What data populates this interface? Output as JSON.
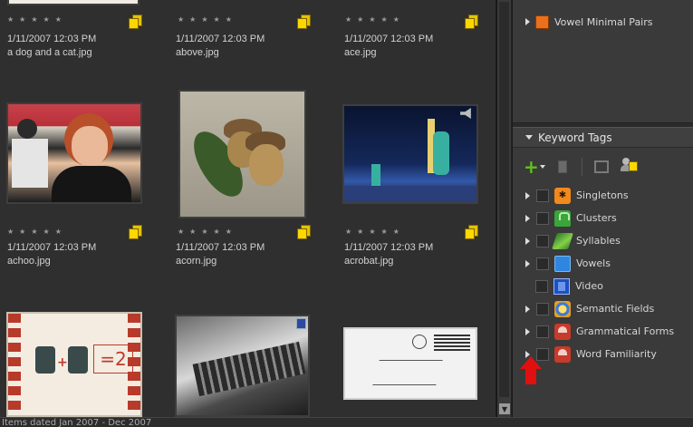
{
  "colors": {
    "accent_orange": "#e8701e",
    "rating_gray": "#9b9b9b",
    "arrow_red": "#e01010"
  },
  "grid": {
    "items": [
      {
        "stars": "★★★★★",
        "date": "1/11/2007 12:03 PM",
        "name": "a dog and a cat.jpg",
        "version_stack": true
      },
      {
        "stars": "★★★★★",
        "date": "1/11/2007 12:03 PM",
        "name": "above.jpg",
        "version_stack": true
      },
      {
        "stars": "★★★★★",
        "date": "1/11/2007 12:03 PM",
        "name": "ace.jpg",
        "version_stack": true
      },
      {
        "stars": "★★★★★",
        "date": "1/11/2007 12:03 PM",
        "name": "achoo.jpg",
        "version_stack": true
      },
      {
        "stars": "★★★★★",
        "date": "1/11/2007 12:03 PM",
        "name": "acorn.jpg",
        "version_stack": true
      },
      {
        "stars": "★★★★★",
        "date": "1/11/2007 12:03 PM",
        "name": "acrobat.jpg",
        "version_stack": true
      }
    ],
    "bottom_row_images": [
      "game card",
      "typewriter",
      "envelope"
    ]
  },
  "collections": {
    "visible_item": "Vowel Minimal Pairs"
  },
  "keyword_panel": {
    "title": "Keyword Tags",
    "toolbar": {
      "new_icon": "plus-icon",
      "delete_icon": "trash-icon",
      "edit_icon": "pencil-icon",
      "find_people_icon": "people-tag-icon"
    },
    "tags": [
      {
        "label": "Singletons",
        "icon": "singletons-icon"
      },
      {
        "label": "Clusters",
        "icon": "clusters-icon"
      },
      {
        "label": "Syllables",
        "icon": "syllables-icon"
      },
      {
        "label": "Vowels",
        "icon": "vowels-icon"
      },
      {
        "label": "Video",
        "icon": "video-icon"
      },
      {
        "label": "Semantic Fields",
        "icon": "semantic-fields-icon"
      },
      {
        "label": "Grammatical Forms",
        "icon": "grammatical-forms-icon"
      },
      {
        "label": "Word Familiarity",
        "icon": "word-familiarity-icon"
      }
    ]
  },
  "statusbar": {
    "text": "Items dated Jan 2007 - Dec 2007"
  }
}
